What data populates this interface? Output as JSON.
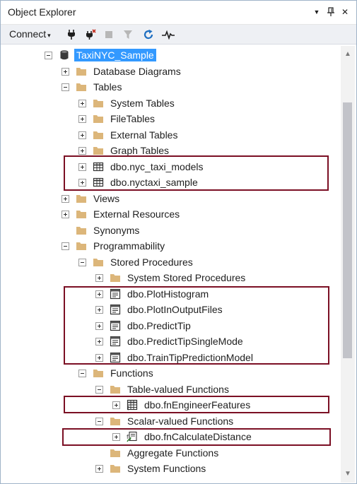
{
  "window": {
    "title": "Object Explorer",
    "pin_glyph": "▼",
    "autohide_glyph": "📌",
    "close_glyph": "✕"
  },
  "toolbar": {
    "connect_label": "Connect",
    "connect_caret": "▾",
    "icons": [
      "connect-plug-icon",
      "disconnect-plug-icon",
      "stop-icon",
      "filter-icon",
      "refresh-icon",
      "activity-monitor-icon"
    ]
  },
  "tree": {
    "root": "TaxiNYC_Sample",
    "database_diagrams": "Database Diagrams",
    "tables": "Tables",
    "system_tables": "System Tables",
    "file_tables": "FileTables",
    "external_tables": "External Tables",
    "graph_tables": "Graph Tables",
    "table_1": "dbo.nyc_taxi_models",
    "table_2": "dbo.nyctaxi_sample",
    "views": "Views",
    "external_resources": "External Resources",
    "synonyms": "Synonyms",
    "programmability": "Programmability",
    "stored_procedures": "Stored Procedures",
    "system_stored_procedures": "System Stored Procedures",
    "proc_1": "dbo.PlotHistogram",
    "proc_2": "dbo.PlotInOutputFiles",
    "proc_3": "dbo.PredictTip",
    "proc_4": "dbo.PredictTipSingleMode",
    "proc_5": "dbo.TrainTipPredictionModel",
    "functions": "Functions",
    "table_valued_functions": "Table-valued Functions",
    "tvf_1": "dbo.fnEngineerFeatures",
    "scalar_valued_functions": "Scalar-valued Functions",
    "svf_1": "dbo.fnCalculateDistance",
    "aggregate_functions": "Aggregate Functions",
    "system_functions": "System Functions"
  },
  "colors": {
    "selection": "#3399ff",
    "highlight_box": "#7b0f24",
    "folder": "#dcb67a",
    "toolbar_bg": "#eef0f4",
    "refresh": "#1e6fc1"
  }
}
